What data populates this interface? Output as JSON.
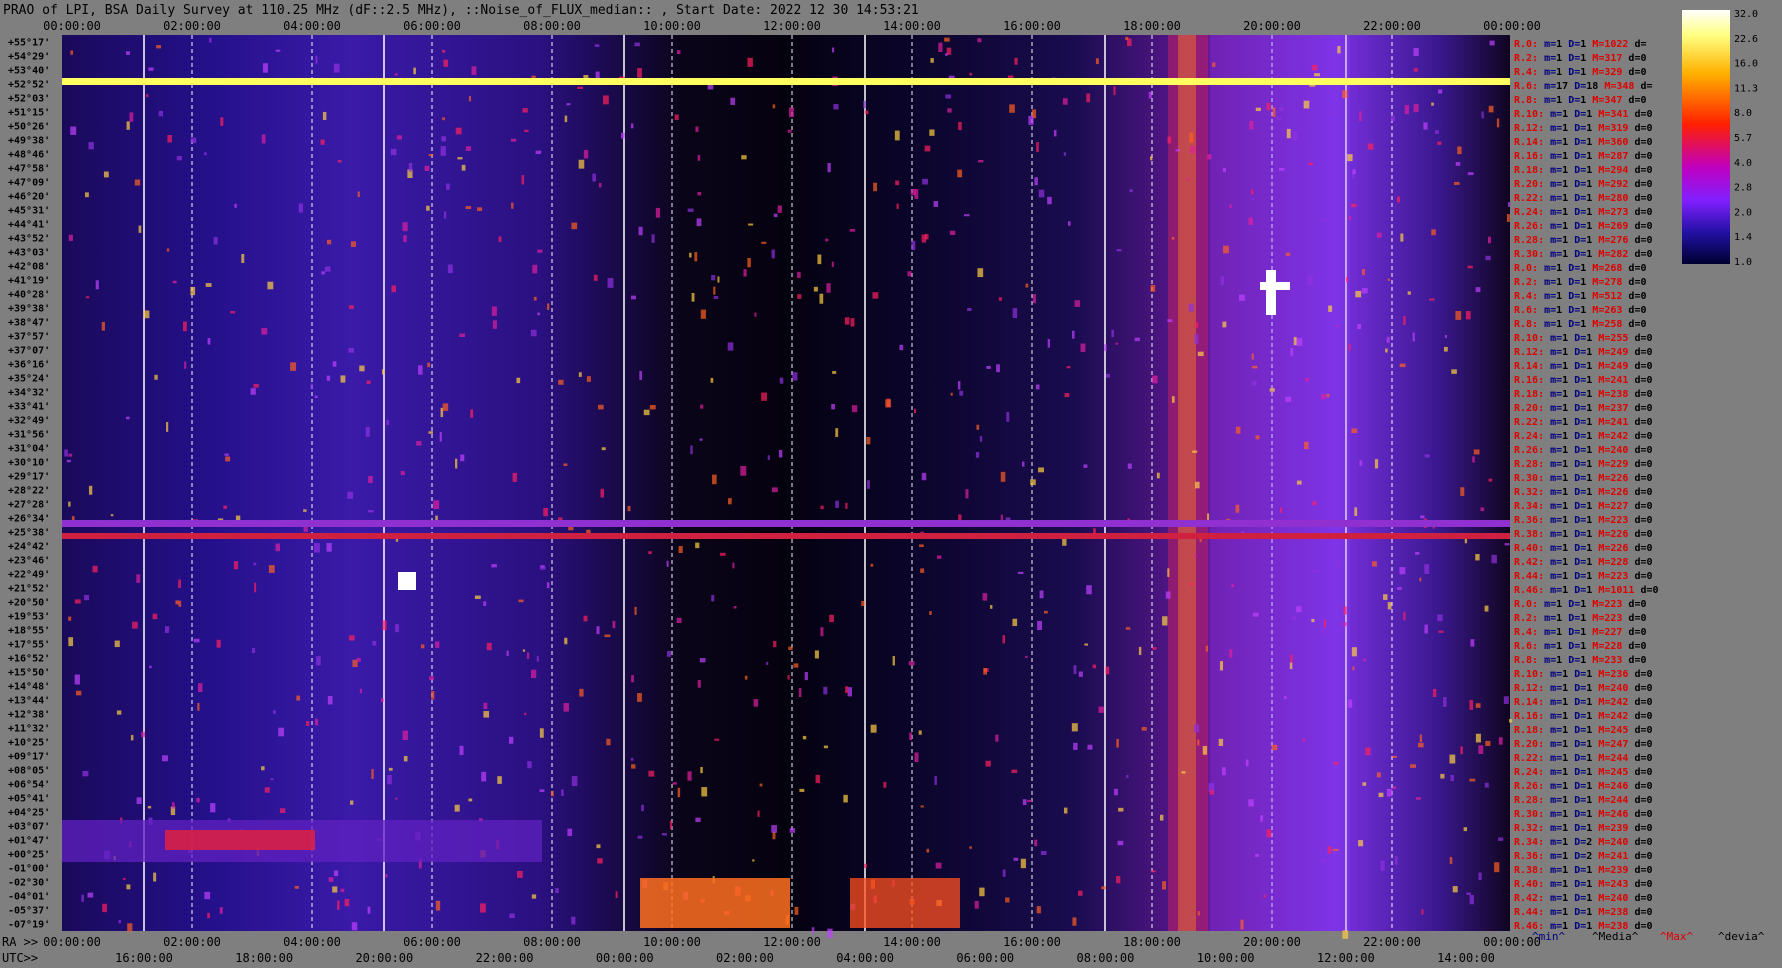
{
  "chart_data": {
    "type": "heatmap",
    "title": "PRAO of LPI, BSA Daily Survey at 110.25 MHz (dF::2.5 MHz), ::Noise_of_FLUX_median:: , Start Date: 2022 12 30 14:53:21",
    "top_axis_ticks": [
      "00:00:00",
      "02:00:00",
      "04:00:00",
      "06:00:00",
      "08:00:00",
      "10:00:00",
      "12:00:00",
      "14:00:00",
      "16:00:00",
      "18:00:00",
      "20:00:00",
      "22:00:00",
      "00:00:00"
    ],
    "bottom_ra_prefix": "RA >>",
    "bottom_ra_ticks": [
      "00:00:00",
      "02:00:00",
      "04:00:00",
      "06:00:00",
      "08:00:00",
      "10:00:00",
      "12:00:00",
      "14:00:00",
      "16:00:00",
      "18:00:00",
      "20:00:00",
      "22:00:00",
      "00:00:00"
    ],
    "bottom_utc_prefix": "UTC>>",
    "bottom_utc_ticks": [
      "16:00:00",
      "18:00:00",
      "20:00:00",
      "22:00:00",
      "00:00:00",
      "02:00:00",
      "04:00:00",
      "06:00:00",
      "08:00:00",
      "10:00:00",
      "12:00:00",
      "14:00:00"
    ],
    "declinations": [
      "+55°17'",
      "+54°29'",
      "+53°40'",
      "+52°52'",
      "+52°03'",
      "+51°15'",
      "+50°26'",
      "+49°38'",
      "+48°46'",
      "+47°58'",
      "+47°09'",
      "+46°20'",
      "+45°31'",
      "+44°41'",
      "+43°52'",
      "+43°03'",
      "+42°08'",
      "+41°19'",
      "+40°28'",
      "+39°38'",
      "+38°47'",
      "+37°57'",
      "+37°07'",
      "+36°16'",
      "+35°24'",
      "+34°32'",
      "+33°41'",
      "+32°49'",
      "+31°56'",
      "+31°04'",
      "+30°10'",
      "+29°17'",
      "+28°22'",
      "+27°28'",
      "+26°34'",
      "+25°38'",
      "+24°42'",
      "+23°46'",
      "+22°49'",
      "+21°52'",
      "+20°50'",
      "+19°53'",
      "+18°55'",
      "+17°55'",
      "+16°52'",
      "+15°50'",
      "+14°48'",
      "+13°44'",
      "+12°38'",
      "+11°32'",
      "+10°25'",
      "+09°17'",
      "+08°05'",
      "+06°54'",
      "+05°41'",
      "+04°25'",
      "+03°07'",
      "+01°47'",
      "+00°25'",
      "-01°00'",
      "-02°30'",
      "-04°01'",
      "-05°37'",
      "-07°19'"
    ],
    "colorbar_ticks": [
      "32.0",
      "22.6",
      "16.0",
      "11.3",
      "8.0",
      "5.7",
      "4.0",
      "2.8",
      "2.0",
      "1.4",
      "1.0"
    ],
    "row_stats": [
      {
        "r": "R.0:",
        "m": "1",
        "D": "1",
        "M": "1022",
        "d": ""
      },
      {
        "r": "R.2:",
        "m": "1",
        "D": "1",
        "M": "317",
        "d": "0"
      },
      {
        "r": "R.4:",
        "m": "1",
        "D": "1",
        "M": "329",
        "d": "0"
      },
      {
        "r": "R.6:",
        "m": "17",
        "D": "18",
        "M": "348",
        "d": ""
      },
      {
        "r": "R.8:",
        "m": "1",
        "D": "1",
        "M": "347",
        "d": "0"
      },
      {
        "r": "R.10:",
        "m": "1",
        "D": "1",
        "M": "341",
        "d": "0"
      },
      {
        "r": "R.12:",
        "m": "1",
        "D": "1",
        "M": "319",
        "d": "0"
      },
      {
        "r": "R.14:",
        "m": "1",
        "D": "1",
        "M": "360",
        "d": "0"
      },
      {
        "r": "R.16:",
        "m": "1",
        "D": "1",
        "M": "287",
        "d": "0"
      },
      {
        "r": "R.18:",
        "m": "1",
        "D": "1",
        "M": "294",
        "d": "0"
      },
      {
        "r": "R.20:",
        "m": "1",
        "D": "1",
        "M": "292",
        "d": "0"
      },
      {
        "r": "R.22:",
        "m": "1",
        "D": "1",
        "M": "280",
        "d": "0"
      },
      {
        "r": "R.24:",
        "m": "1",
        "D": "1",
        "M": "273",
        "d": "0"
      },
      {
        "r": "R.26:",
        "m": "1",
        "D": "1",
        "M": "269",
        "d": "0"
      },
      {
        "r": "R.28:",
        "m": "1",
        "D": "1",
        "M": "276",
        "d": "0"
      },
      {
        "r": "R.30:",
        "m": "1",
        "D": "1",
        "M": "282",
        "d": "0"
      },
      {
        "r": "R.0:",
        "m": "1",
        "D": "1",
        "M": "268",
        "d": "0"
      },
      {
        "r": "R.2:",
        "m": "1",
        "D": "1",
        "M": "278",
        "d": "0"
      },
      {
        "r": "R.4:",
        "m": "1",
        "D": "1",
        "M": "512",
        "d": "0"
      },
      {
        "r": "R.6:",
        "m": "1",
        "D": "1",
        "M": "263",
        "d": "0"
      },
      {
        "r": "R.8:",
        "m": "1",
        "D": "1",
        "M": "258",
        "d": "0"
      },
      {
        "r": "R.10:",
        "m": "1",
        "D": "1",
        "M": "255",
        "d": "0"
      },
      {
        "r": "R.12:",
        "m": "1",
        "D": "1",
        "M": "249",
        "d": "0"
      },
      {
        "r": "R.14:",
        "m": "1",
        "D": "1",
        "M": "249",
        "d": "0"
      },
      {
        "r": "R.16:",
        "m": "1",
        "D": "1",
        "M": "241",
        "d": "0"
      },
      {
        "r": "R.18:",
        "m": "1",
        "D": "1",
        "M": "238",
        "d": "0"
      },
      {
        "r": "R.20:",
        "m": "1",
        "D": "1",
        "M": "237",
        "d": "0"
      },
      {
        "r": "R.22:",
        "m": "1",
        "D": "1",
        "M": "241",
        "d": "0"
      },
      {
        "r": "R.24:",
        "m": "1",
        "D": "1",
        "M": "242",
        "d": "0"
      },
      {
        "r": "R.26:",
        "m": "1",
        "D": "1",
        "M": "240",
        "d": "0"
      },
      {
        "r": "R.28:",
        "m": "1",
        "D": "1",
        "M": "229",
        "d": "0"
      },
      {
        "r": "R.30:",
        "m": "1",
        "D": "1",
        "M": "226",
        "d": "0"
      },
      {
        "r": "R.32:",
        "m": "1",
        "D": "1",
        "M": "226",
        "d": "0"
      },
      {
        "r": "R.34:",
        "m": "1",
        "D": "1",
        "M": "227",
        "d": "0"
      },
      {
        "r": "R.36:",
        "m": "1",
        "D": "1",
        "M": "223",
        "d": "0"
      },
      {
        "r": "R.38:",
        "m": "1",
        "D": "1",
        "M": "226",
        "d": "0"
      },
      {
        "r": "R.40:",
        "m": "1",
        "D": "1",
        "M": "226",
        "d": "0"
      },
      {
        "r": "R.42:",
        "m": "1",
        "D": "1",
        "M": "228",
        "d": "0"
      },
      {
        "r": "R.44:",
        "m": "1",
        "D": "1",
        "M": "223",
        "d": "0"
      },
      {
        "r": "R.46:",
        "m": "1",
        "D": "1",
        "M": "1011",
        "d": "0"
      },
      {
        "r": "R.0:",
        "m": "1",
        "D": "1",
        "M": "223",
        "d": "0"
      },
      {
        "r": "R.2:",
        "m": "1",
        "D": "1",
        "M": "223",
        "d": "0"
      },
      {
        "r": "R.4:",
        "m": "1",
        "D": "1",
        "M": "227",
        "d": "0"
      },
      {
        "r": "R.6:",
        "m": "1",
        "D": "1",
        "M": "228",
        "d": "0"
      },
      {
        "r": "R.8:",
        "m": "1",
        "D": "1",
        "M": "233",
        "d": "0"
      },
      {
        "r": "R.10:",
        "m": "1",
        "D": "1",
        "M": "236",
        "d": "0"
      },
      {
        "r": "R.12:",
        "m": "1",
        "D": "1",
        "M": "240",
        "d": "0"
      },
      {
        "r": "R.14:",
        "m": "1",
        "D": "1",
        "M": "242",
        "d": "0"
      },
      {
        "r": "R.16:",
        "m": "1",
        "D": "1",
        "M": "242",
        "d": "0"
      },
      {
        "r": "R.18:",
        "m": "1",
        "D": "1",
        "M": "245",
        "d": "0"
      },
      {
        "r": "R.20:",
        "m": "1",
        "D": "1",
        "M": "247",
        "d": "0"
      },
      {
        "r": "R.22:",
        "m": "1",
        "D": "1",
        "M": "244",
        "d": "0"
      },
      {
        "r": "R.24:",
        "m": "1",
        "D": "1",
        "M": "245",
        "d": "0"
      },
      {
        "r": "R.26:",
        "m": "1",
        "D": "1",
        "M": "246",
        "d": "0"
      },
      {
        "r": "R.28:",
        "m": "1",
        "D": "1",
        "M": "244",
        "d": "0"
      },
      {
        "r": "R.30:",
        "m": "1",
        "D": "1",
        "M": "246",
        "d": "0"
      },
      {
        "r": "R.32:",
        "m": "1",
        "D": "1",
        "M": "239",
        "d": "0"
      },
      {
        "r": "R.34:",
        "m": "1",
        "D": "2",
        "M": "240",
        "d": "0"
      },
      {
        "r": "R.36:",
        "m": "1",
        "D": "2",
        "M": "241",
        "d": "0"
      },
      {
        "r": "R.38:",
        "m": "1",
        "D": "1",
        "M": "239",
        "d": "0"
      },
      {
        "r": "R.40:",
        "m": "1",
        "D": "1",
        "M": "243",
        "d": "0"
      },
      {
        "r": "R.42:",
        "m": "1",
        "D": "1",
        "M": "240",
        "d": "0"
      },
      {
        "r": "R.44:",
        "m": "1",
        "D": "1",
        "M": "238",
        "d": "0"
      },
      {
        "r": "R.46:",
        "m": "1",
        "D": "1",
        "M": "238",
        "d": "0"
      }
    ],
    "stats_key_labels": {
      "r": "R.",
      "m": "m=",
      "D": "D=",
      "M": "M=",
      "d": "d="
    },
    "footer_labels": [
      "^min^",
      "^Media^",
      "^Max^",
      "^devia^"
    ],
    "colors": {
      "background": "#7f7f7f",
      "stat_red": "#e00000",
      "stat_blue": "#000080",
      "heat_low": "#000040",
      "heat_mid": "#9b30ff",
      "heat_high": "#ffff40"
    }
  }
}
